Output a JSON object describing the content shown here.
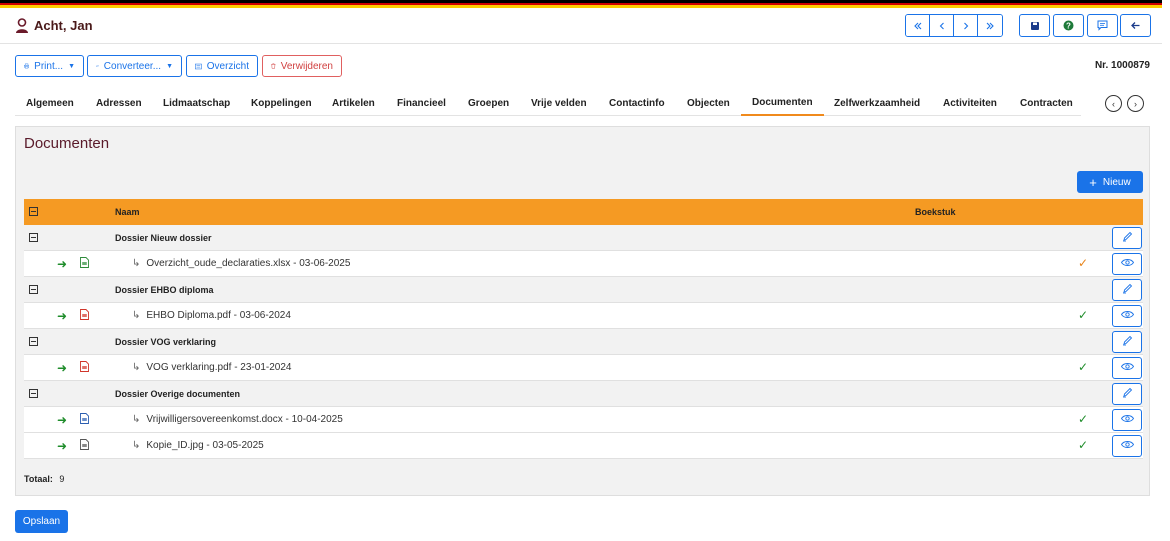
{
  "header": {
    "user_name": "Acht, Jan",
    "nav_icons": [
      "first-icon",
      "previous-icon",
      "next-icon",
      "last-icon"
    ],
    "action_icons": [
      "save-icon",
      "help-icon",
      "comment-icon",
      "back-icon"
    ]
  },
  "toolbar": {
    "print_label": "Print...",
    "convert_label": "Converteer...",
    "overview_label": "Overzicht",
    "delete_label": "Verwijderen",
    "record_number": "Nr. 1000879"
  },
  "tabs": [
    {
      "label": "Algemeen"
    },
    {
      "label": "Adressen"
    },
    {
      "label": "Lidmaatschap"
    },
    {
      "label": "Koppelingen"
    },
    {
      "label": "Artikelen"
    },
    {
      "label": "Financieel"
    },
    {
      "label": "Groepen"
    },
    {
      "label": "Vrije velden"
    },
    {
      "label": "Contactinfo"
    },
    {
      "label": "Objecten"
    },
    {
      "label": "Documenten"
    },
    {
      "label": "Zelfwerkzaamheid"
    },
    {
      "label": "Activiteiten"
    },
    {
      "label": "Contracten"
    }
  ],
  "active_tab": "Documenten",
  "panel": {
    "title": "Documenten",
    "new_label": "Nieuw",
    "columns": {
      "name": "Naam",
      "booking": "Boekstuk"
    },
    "groups": [
      {
        "name": "Dossier Nieuw dossier",
        "docs": [
          {
            "name": "Overzicht_oude_declaraties.xlsx - 03-06-2025",
            "file_type": "xlsx",
            "check_color": "#e8841a"
          }
        ]
      },
      {
        "name": "Dossier EHBO diploma",
        "docs": [
          {
            "name": "EHBO Diploma.pdf - 03-06-2024",
            "file_type": "pdf",
            "check_color": "#1e8c2a"
          }
        ]
      },
      {
        "name": "Dossier VOG verklaring",
        "docs": [
          {
            "name": "VOG verklaring.pdf - 23-01-2024",
            "file_type": "pdf",
            "check_color": "#1e8c2a"
          }
        ]
      },
      {
        "name": "Dossier Overige documenten",
        "docs": [
          {
            "name": "Vrijwilligersovereenkomst.docx - 10-04-2025",
            "file_type": "docx",
            "check_color": "#1e8c2a"
          },
          {
            "name": "Kopie_ID.jpg - 03-05-2025",
            "file_type": "jpg",
            "check_color": "#1e8c2a"
          }
        ]
      }
    ],
    "total_label": "Totaal:",
    "total_value": "9"
  },
  "footer": {
    "save_label": "Opslaan"
  },
  "colors": {
    "accent": "#1a73e8",
    "header_orange": "#f59a23",
    "title": "#5a1a2a"
  }
}
